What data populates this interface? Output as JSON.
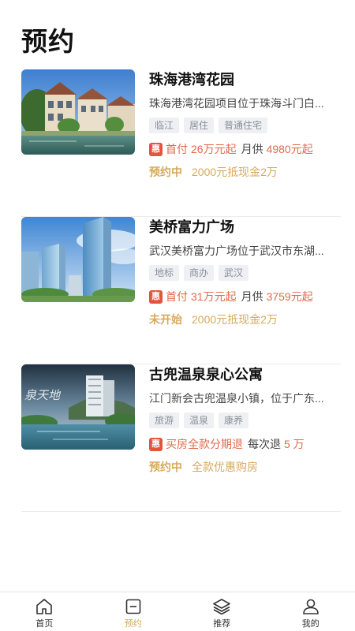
{
  "page": {
    "title": "预约"
  },
  "projects": [
    {
      "name": "珠海港湾花园",
      "desc": "珠海港湾花园项目位于珠海斗门白...",
      "tags": [
        "临江",
        "居住",
        "普通住宅"
      ],
      "badge": "惠",
      "price_label": "首付",
      "price_value": "26万元起",
      "monthly_label": "月供",
      "monthly_value": "4980元起",
      "status": "预约中",
      "promo": "2000元抵现金2万",
      "image_icon": "villa-riverside-photo"
    },
    {
      "name": "美桥富力广场",
      "desc": "武汉美桥富力广场位于武汉市东湖...",
      "tags": [
        "地标",
        "商办",
        "武汉"
      ],
      "badge": "惠",
      "price_label": "首付",
      "price_value": "31万元起",
      "monthly_label": "月供",
      "monthly_value": "3759元起",
      "status": "未开始",
      "promo": "2000元抵现金2万",
      "image_icon": "glass-towers-photo"
    },
    {
      "name": "古兜温泉泉心公寓",
      "desc": "江门新会古兜温泉小镇，位于广东...",
      "tags": [
        "旅游",
        "温泉",
        "康养"
      ],
      "badge": "惠",
      "price_label": "买房全款分期退",
      "price_value": "",
      "monthly_label": "每次退",
      "monthly_value": "5 万",
      "status": "预约中",
      "promo": "全款优惠购房",
      "image_icon": "hotspring-resort-photo"
    }
  ],
  "tabbar": {
    "items": [
      {
        "label": "首页",
        "icon": "home-icon"
      },
      {
        "label": "预约",
        "icon": "reservation-icon"
      },
      {
        "label": "推荐",
        "icon": "layers-icon"
      },
      {
        "label": "我的",
        "icon": "user-icon"
      }
    ],
    "active_index": 1,
    "active_color": "#d7a95b"
  },
  "colors": {
    "accent": "#d7a95b",
    "price": "#e06a4e",
    "badge": "#e2543b"
  }
}
